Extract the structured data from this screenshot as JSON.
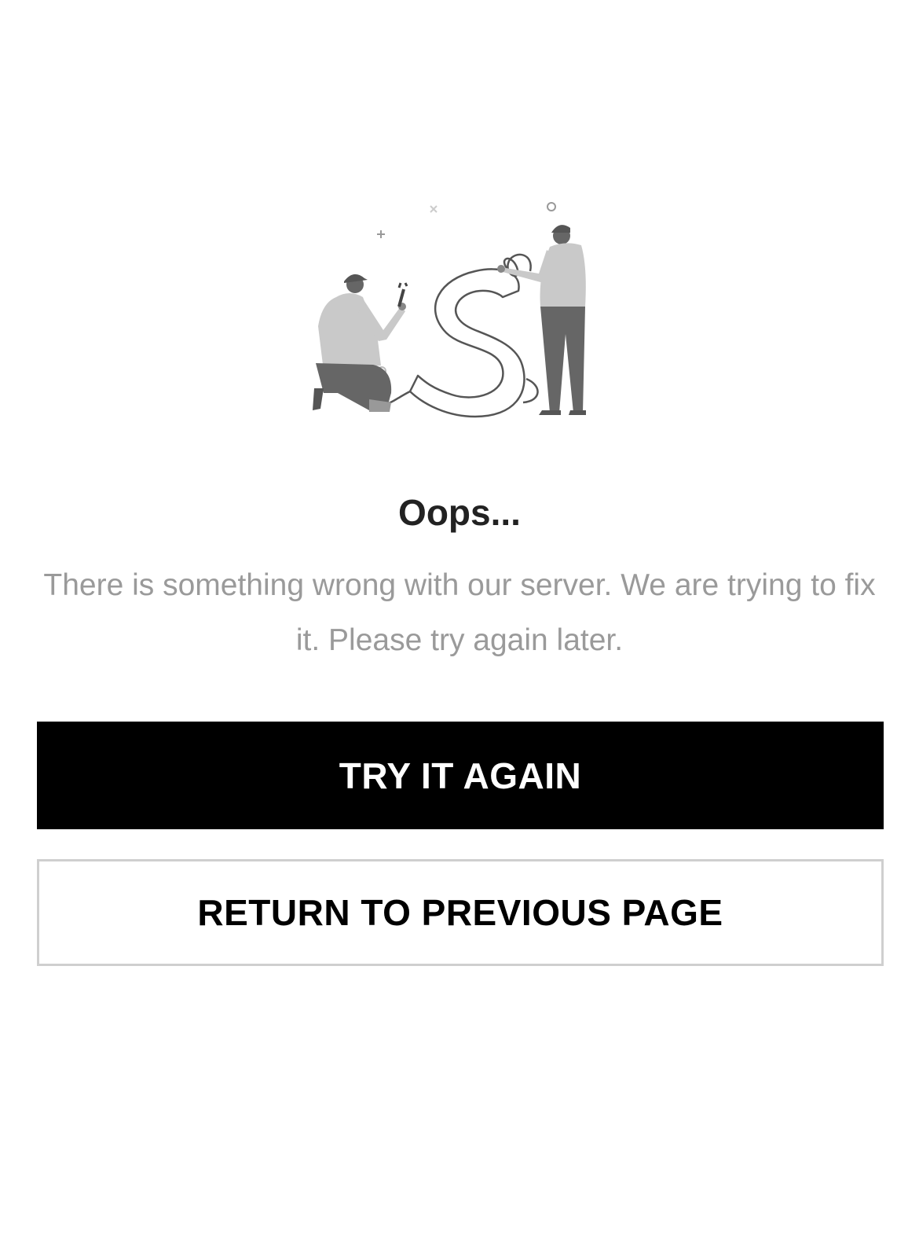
{
  "error": {
    "title": "Oops...",
    "message": "There is something wrong with our server. We are trying to fix it. Please try again later."
  },
  "actions": {
    "retry_label": "TRY IT AGAIN",
    "back_label": "RETURN TO PREVIOUS PAGE"
  },
  "illustration": {
    "icon": "repair-workers-illustration",
    "letter": "S"
  },
  "colors": {
    "primary_button_bg": "#000000",
    "primary_button_text": "#ffffff",
    "secondary_button_border": "#cfcfcf",
    "title": "#222222",
    "message": "#9a9a9a"
  }
}
